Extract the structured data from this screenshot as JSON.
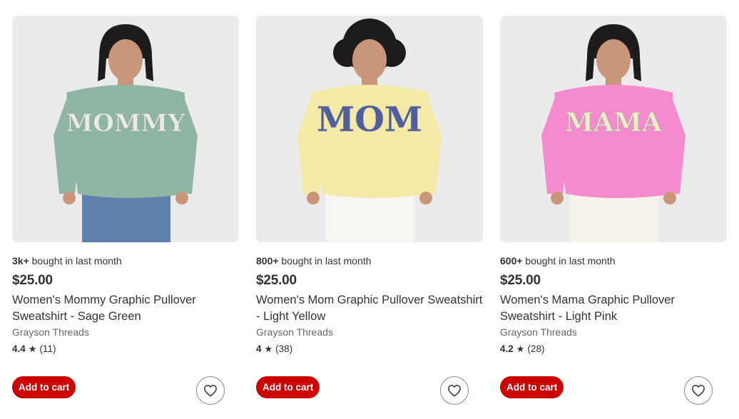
{
  "products": [
    {
      "bought_count": "3k+",
      "bought_suffix": " bought in last month",
      "price": "$25.00",
      "title": "Women's Mommy Graphic Pullover Sweatshirt - Sage Green",
      "brand": "Grayson Threads",
      "rating": "4.4",
      "review_count": "(11)",
      "add_to_cart_label": "Add to cart",
      "image": {
        "graphic_text": "MOMMY",
        "sweatshirt_color": "#8fb5a3",
        "graphic_color": "#e8ece4",
        "hair_style": "bob",
        "pants_color": "#5e82ad"
      }
    },
    {
      "bought_count": "800+",
      "bought_suffix": " bought in last month",
      "price": "$25.00",
      "title": "Women's Mom Graphic Pullover Sweatshirt - Light Yellow",
      "brand": "Grayson Threads",
      "rating": "4",
      "review_count": "(38)",
      "add_to_cart_label": "Add to cart",
      "image": {
        "graphic_text": "MOM",
        "sweatshirt_color": "#f5e9a8",
        "graphic_color": "#4f5f9e",
        "hair_style": "curly",
        "pants_color": "#f7f6f2"
      }
    },
    {
      "bought_count": "600+",
      "bought_suffix": " bought in last month",
      "price": "$25.00",
      "title": "Women's Mama Graphic Pullover Sweatshirt - Light Pink",
      "brand": "Grayson Threads",
      "rating": "4.2",
      "review_count": "(28)",
      "add_to_cart_label": "Add to cart",
      "image": {
        "graphic_text": "MAMA",
        "sweatshirt_color": "#f58bce",
        "graphic_color": "#f4e9c8",
        "hair_style": "bob",
        "pants_color": "#f4f2ea"
      }
    }
  ],
  "icons": {
    "star": "star-icon",
    "wishlist": "heart-icon"
  },
  "colors": {
    "cta": "#cc0000",
    "image_bg": "#ebebeb",
    "text": "#333333",
    "muted": "#666666"
  }
}
